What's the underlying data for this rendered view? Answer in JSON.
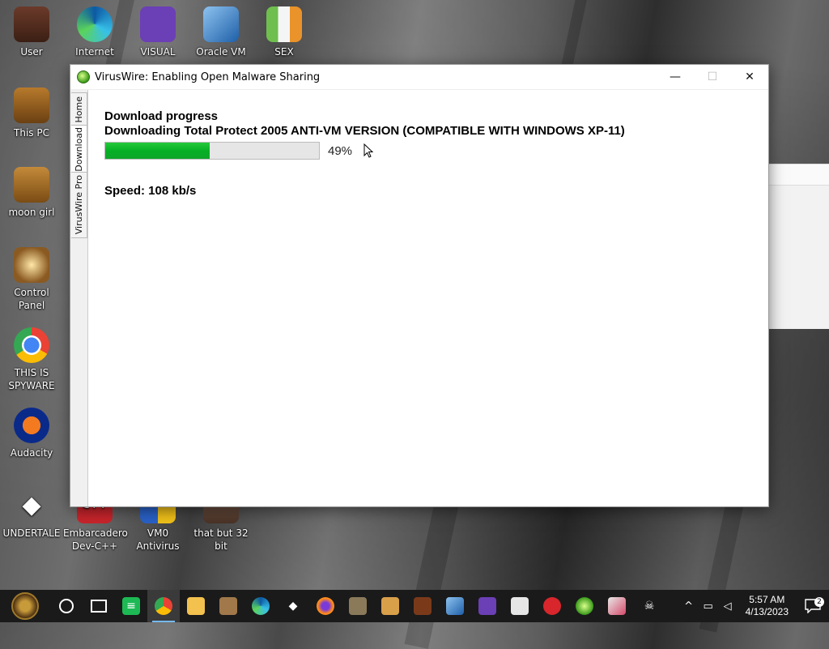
{
  "desktop": {
    "icons": [
      {
        "label": "User"
      },
      {
        "label": "Internet"
      },
      {
        "label": "VISUAL"
      },
      {
        "label": "Oracle VM"
      },
      {
        "label": "SEX"
      },
      {
        "label": "This PC"
      },
      {
        "label": "moon girl"
      },
      {
        "label": "Control Panel"
      },
      {
        "label": "THIS IS SPYWARE"
      },
      {
        "label": "Audacity"
      },
      {
        "label": "UNDERTALE"
      },
      {
        "label": "Embarcadero Dev-C++"
      },
      {
        "label": "VM0 Antivirus"
      },
      {
        "label": "that but 32 bit"
      }
    ]
  },
  "window": {
    "title": "VirusWire: Enabling Open Malware Sharing",
    "controls": {
      "minimize": "—",
      "maximize": "☐",
      "close": "✕"
    },
    "tabs": [
      {
        "label": "Home"
      },
      {
        "label": "Download"
      },
      {
        "label": "VirusWire Pro"
      }
    ],
    "content": {
      "heading": "Download progress",
      "subheading": "Downloading Total Protect 2005 ANTI-VM VERSION (COMPATIBLE WITH WINDOWS XP-11)",
      "progress_fraction": 0.49,
      "percent_text": "49%",
      "speed_text": "Speed: 108 kb/s"
    }
  },
  "taskbar": {
    "icons": [
      "start-orb",
      "search-circle",
      "task-view",
      "spotify",
      "chrome",
      "file-explorer",
      "app-figure",
      "edge",
      "unity",
      "firefox",
      "gimp",
      "user-app",
      "thumbnail-app",
      "virtualbox",
      "visual-studio",
      "game-app",
      "red-app",
      "viruswire",
      "photo-app",
      "skull-app"
    ],
    "clock_time": "5:57 AM",
    "clock_date": "4/13/2023",
    "notification_count": "2"
  },
  "colors": {
    "progress_green": "#06b025",
    "taskbar_bg": "#1a1a1a"
  }
}
